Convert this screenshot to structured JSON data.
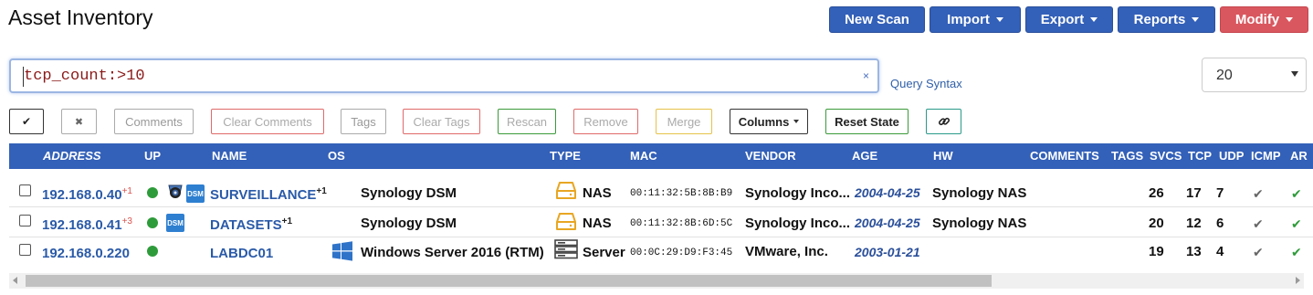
{
  "page": {
    "title": "Asset Inventory"
  },
  "toolbar": {
    "new_scan": "New Scan",
    "import": "Import",
    "export": "Export",
    "reports": "Reports",
    "modify": "Modify"
  },
  "search": {
    "query": "tcp_count:>10",
    "clear_icon": "×",
    "syntax_link": "Query Syntax"
  },
  "page_size": {
    "selected": "20"
  },
  "actions": {
    "check": "✔",
    "uncheck": "✖",
    "comments": "Comments",
    "clear_comments": "Clear Comments",
    "tags": "Tags",
    "clear_tags": "Clear Tags",
    "rescan": "Rescan",
    "remove": "Remove",
    "merge": "Merge",
    "columns": "Columns",
    "reset_state": "Reset State",
    "link_icon": "link-icon"
  },
  "columns": [
    "ADDRESS",
    "UP",
    "NAME",
    "OS",
    "TYPE",
    "MAC",
    "VENDOR",
    "AGE",
    "HW",
    "COMMENTS",
    "TAGS",
    "SVCS",
    "TCP",
    "UDP",
    "ICMP",
    "AR"
  ],
  "rows": [
    {
      "address": "192.168.0.40",
      "address_extra": "+1",
      "name": "SURVEILLANCE",
      "name_extra": "+1",
      "icons": [
        "camera-icon",
        "dsm-icon"
      ],
      "os": "Synology DSM",
      "os_icon": "",
      "type": "NAS",
      "type_icon": "nas-drive-icon",
      "mac": "00:11:32:5B:8B:B9",
      "vendor": "Synology Inco...",
      "age": "2004-04-25",
      "hw": "Synology NAS",
      "svcs": "26",
      "tcp": "17",
      "udp": "7",
      "icmp": "✔",
      "ar": "✔"
    },
    {
      "address": "192.168.0.41",
      "address_extra": "+3",
      "name": "DATASETS",
      "name_extra": "+1",
      "icons": [
        "dsm-icon"
      ],
      "os": "Synology DSM",
      "os_icon": "",
      "type": "NAS",
      "type_icon": "nas-drive-icon",
      "mac": "00:11:32:8B:6D:5C",
      "vendor": "Synology Inco...",
      "age": "2004-04-25",
      "hw": "Synology NAS",
      "svcs": "20",
      "tcp": "12",
      "udp": "6",
      "icmp": "✔",
      "ar": "✔"
    },
    {
      "address": "192.168.0.220",
      "address_extra": "",
      "name": "LABDC01",
      "name_extra": "",
      "icons": [],
      "os": "Windows Server 2016 (RTM)",
      "os_icon": "windows-icon",
      "type": "Server",
      "type_icon": "server-icon",
      "mac": "00:0C:29:D9:F3:45",
      "vendor": "VMware, Inc.",
      "age": "2003-01-21",
      "hw": "",
      "svcs": "19",
      "tcp": "13",
      "udp": "4",
      "icmp": "✔",
      "ar": "✔"
    }
  ],
  "dsm_badge": "DSM",
  "colors": {
    "primary": "#3360b8",
    "danger": "#d9575f",
    "up": "#2e9b3a"
  }
}
